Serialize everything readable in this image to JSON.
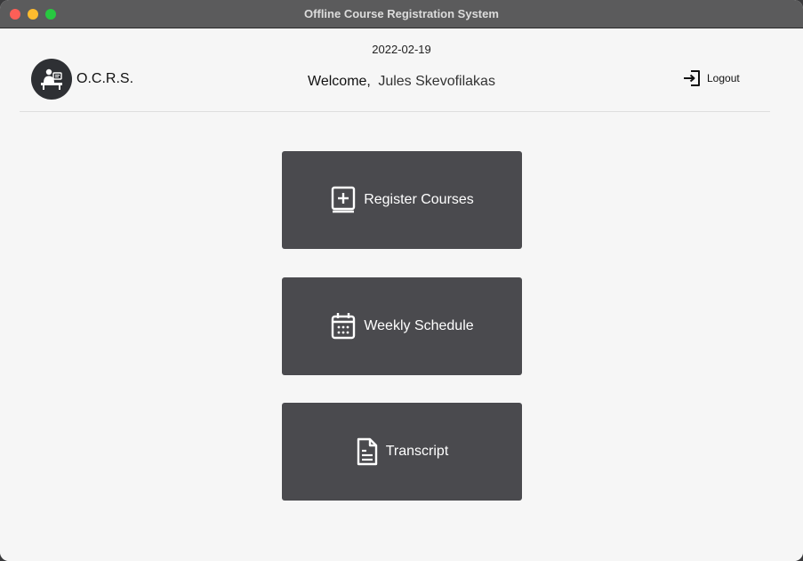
{
  "window": {
    "title": "Offline Course Registration System"
  },
  "header": {
    "date": "2022-02-19",
    "brand": "O.C.R.S.",
    "welcome_label": "Welcome,",
    "user_name": "Jules Skevofilakas",
    "logout_label": "Logout"
  },
  "menu": {
    "register": {
      "label": "Register Courses",
      "icon": "book-plus-icon"
    },
    "schedule": {
      "label": "Weekly Schedule",
      "icon": "calendar-icon"
    },
    "transcript": {
      "label": "Transcript",
      "icon": "document-icon"
    }
  },
  "colors": {
    "window_bg": "#f6f6f6",
    "titlebar": "#5b5b5c",
    "button_bg": "#4a4a4e",
    "logo_bg": "#2e3034"
  }
}
